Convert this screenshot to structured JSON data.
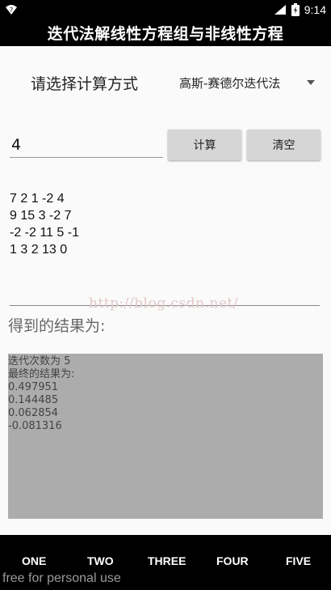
{
  "status_bar": {
    "time": "9:14",
    "left_icon": "wifi-question-icon",
    "right_icons": [
      "signal-icon",
      "battery-icon"
    ]
  },
  "app_bar": {
    "title": "迭代法解线性方程组与非线性方程"
  },
  "form": {
    "mode_label": "请选择计算方式",
    "method_selected": "高斯-赛德尔迭代法",
    "size_value": "4",
    "calc_button": "计算",
    "clear_button": "清空"
  },
  "matrix": {
    "rows": [
      "7 2 1 -2 4",
      "9 15 3 -2 7",
      "-2 -2 11 5 -1",
      "1 3 2 13 0"
    ]
  },
  "watermark": "http://blog.csdn.net/",
  "result": {
    "label": "得到的结果为:",
    "lines": [
      "迭代次数为 5",
      "最终的结果为:",
      "0.497951",
      "0.144485",
      "0.062854",
      "-0.081316"
    ]
  },
  "tabs": [
    "ONE",
    "TWO",
    "THREE",
    "FOUR",
    "FIVE"
  ],
  "footer_note": "free for personal use",
  "colors": {
    "bar_background": "#000000",
    "content_background": "#fafafa",
    "button_background": "#d6d6d6",
    "result_background": "#acacac"
  }
}
